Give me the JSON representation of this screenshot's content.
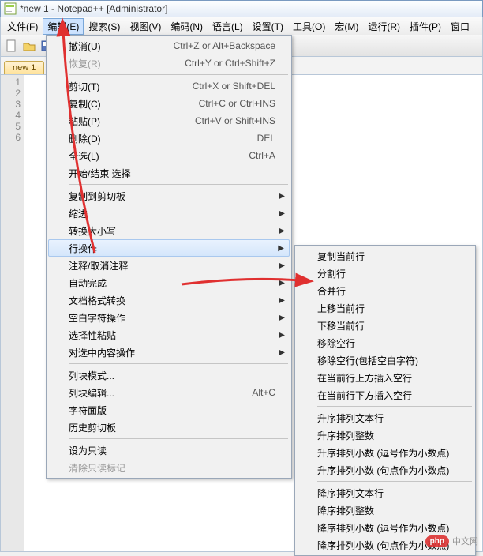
{
  "window": {
    "title": "*new 1 - Notepad++ [Administrator]"
  },
  "menubar": [
    "文件(F)",
    "编辑(E)",
    "搜索(S)",
    "视图(V)",
    "编码(N)",
    "语言(L)",
    "设置(T)",
    "工具(O)",
    "宏(M)",
    "运行(R)",
    "插件(P)",
    "窗口"
  ],
  "tab": {
    "label": "new 1"
  },
  "gutter_lines": [
    "1",
    "2",
    "3",
    "4",
    "5",
    "6"
  ],
  "edit_menu": [
    {
      "t": "item",
      "label": "撤消(U)",
      "accel": "Ctrl+Z or Alt+Backspace"
    },
    {
      "t": "item",
      "label": "恢复(R)",
      "accel": "Ctrl+Y or Ctrl+Shift+Z",
      "disabled": true
    },
    {
      "t": "sep"
    },
    {
      "t": "item",
      "label": "剪切(T)",
      "accel": "Ctrl+X or Shift+DEL"
    },
    {
      "t": "item",
      "label": "复制(C)",
      "accel": "Ctrl+C or Ctrl+INS"
    },
    {
      "t": "item",
      "label": "粘贴(P)",
      "accel": "Ctrl+V or Shift+INS"
    },
    {
      "t": "item",
      "label": "删除(D)",
      "accel": "DEL"
    },
    {
      "t": "item",
      "label": "全选(L)",
      "accel": "Ctrl+A"
    },
    {
      "t": "item",
      "label": "开始/结束 选择"
    },
    {
      "t": "sep"
    },
    {
      "t": "item",
      "label": "复制到剪切板",
      "sub": true
    },
    {
      "t": "item",
      "label": "缩进",
      "sub": true
    },
    {
      "t": "item",
      "label": "转换大小写",
      "sub": true
    },
    {
      "t": "item",
      "label": "行操作",
      "sub": true,
      "hover": true
    },
    {
      "t": "item",
      "label": "注释/取消注释",
      "sub": true
    },
    {
      "t": "item",
      "label": "自动完成",
      "sub": true
    },
    {
      "t": "item",
      "label": "文档格式转换",
      "sub": true
    },
    {
      "t": "item",
      "label": "空白字符操作",
      "sub": true
    },
    {
      "t": "item",
      "label": "选择性粘贴",
      "sub": true
    },
    {
      "t": "item",
      "label": "对选中内容操作",
      "sub": true
    },
    {
      "t": "sep"
    },
    {
      "t": "item",
      "label": "列块模式..."
    },
    {
      "t": "item",
      "label": "列块编辑...",
      "accel": "Alt+C"
    },
    {
      "t": "item",
      "label": "字符面版"
    },
    {
      "t": "item",
      "label": "历史剪切板"
    },
    {
      "t": "sep"
    },
    {
      "t": "item",
      "label": "设为只读"
    },
    {
      "t": "item",
      "label": "清除只读标记",
      "disabled": true
    }
  ],
  "line_submenu": [
    {
      "t": "item",
      "label": "复制当前行"
    },
    {
      "t": "item",
      "label": "分割行"
    },
    {
      "t": "item",
      "label": "合并行"
    },
    {
      "t": "item",
      "label": "上移当前行"
    },
    {
      "t": "item",
      "label": "下移当前行"
    },
    {
      "t": "item",
      "label": "移除空行"
    },
    {
      "t": "item",
      "label": "移除空行(包括空白字符)"
    },
    {
      "t": "item",
      "label": "在当前行上方插入空行"
    },
    {
      "t": "item",
      "label": "在当前行下方插入空行"
    },
    {
      "t": "sep"
    },
    {
      "t": "item",
      "label": "升序排列文本行"
    },
    {
      "t": "item",
      "label": "升序排列整数"
    },
    {
      "t": "item",
      "label": "升序排列小数 (逗号作为小数点)"
    },
    {
      "t": "item",
      "label": "升序排列小数 (句点作为小数点)"
    },
    {
      "t": "sep"
    },
    {
      "t": "item",
      "label": "降序排列文本行"
    },
    {
      "t": "item",
      "label": "降序排列整数"
    },
    {
      "t": "item",
      "label": "降序排列小数 (逗号作为小数点)"
    },
    {
      "t": "item",
      "label": "降序排列小数 (句点作为小数点)"
    }
  ],
  "watermark": {
    "badge": "php",
    "text": "中文网"
  }
}
